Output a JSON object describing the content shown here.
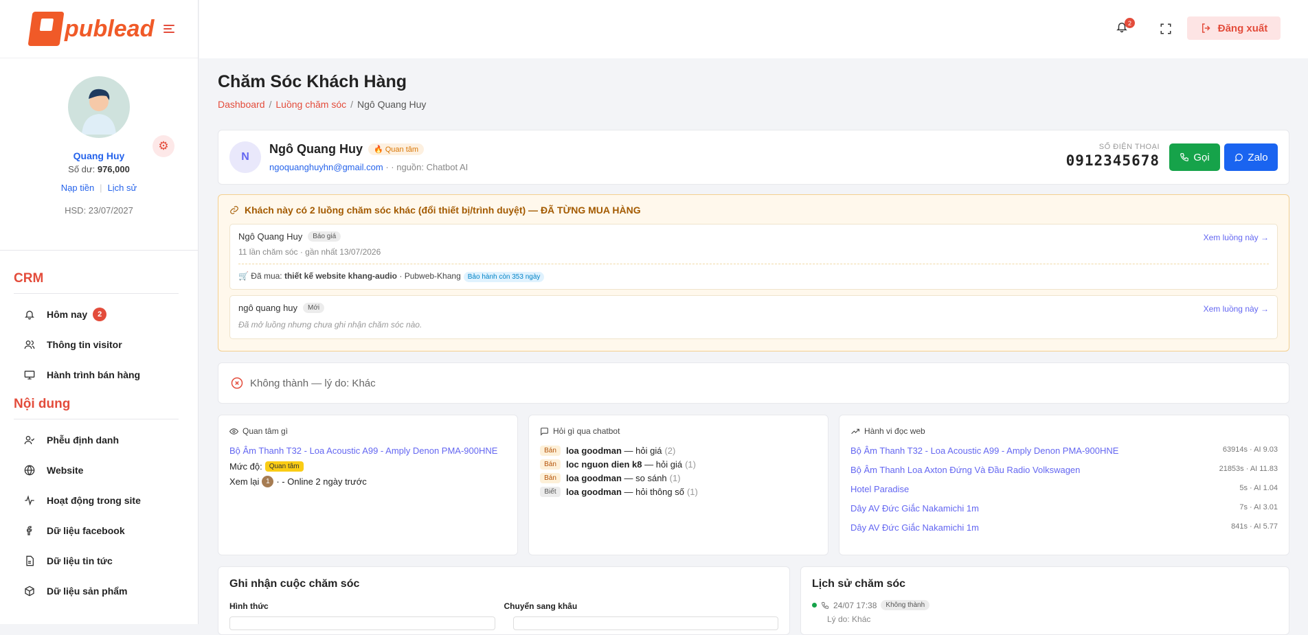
{
  "brand": {
    "name": "publead"
  },
  "profile": {
    "name": "Quang Huy",
    "balance_label": "Số dư:",
    "balance": "976,000",
    "topup": "Nạp tiền",
    "history": "Lịch sử",
    "expiry": "HSD: 23/07/2027"
  },
  "nav": {
    "crm_title": "CRM",
    "crm_items": [
      {
        "label": "Hôm nay",
        "badge": "2"
      },
      {
        "label": "Thông tin visitor"
      },
      {
        "label": "Hành trình bán hàng"
      }
    ],
    "content_title": "Nội dung",
    "content_items": [
      {
        "label": "Phễu định danh"
      },
      {
        "label": "Website"
      },
      {
        "label": "Hoạt động trong site"
      },
      {
        "label": "Dữ liệu facebook"
      },
      {
        "label": "Dữ liệu tin tức"
      },
      {
        "label": "Dữ liệu sản phẩm"
      }
    ]
  },
  "topbar": {
    "notif_count": "2",
    "logout": "Đăng xuất"
  },
  "page": {
    "title": "Chăm Sóc Khách Hàng",
    "breadcrumb": [
      "Dashboard",
      "Luồng chăm sóc",
      "Ngô Quang Huy"
    ]
  },
  "customer": {
    "initial": "N",
    "name": "Ngô Quang Huy",
    "tag": "🔥 Quan tâm",
    "email": "ngoquanghuyhn@gmail.com",
    "source": "· · nguồn: Chatbot AI",
    "phone_label": "SỐ ĐIỆN THOẠI",
    "phone": "0912345678",
    "call": "Gọi",
    "zalo": "Zalo"
  },
  "duplicates": {
    "title": "Khách này có 2 luồng chăm sóc khác (đổi thiết bị/trình duyệt) — ĐÃ TỪNG MUA HÀNG",
    "flows": [
      {
        "name": "Ngô Quang Huy",
        "tag": "Báo giá",
        "meta": "11 lần chăm sóc · gần nhất 13/07/2026",
        "buy_prefix": "🛒 Đã mua:",
        "buy_item": "thiết kế website khang-audio",
        "buy_suffix": "· Pubweb-Khang",
        "warranty": "Bảo hành còn 353 ngày",
        "link": "Xem luồng này →"
      },
      {
        "name": "ngô quang huy",
        "tag": "Mới",
        "note": "Đã mở luồng nhưng chưa ghi nhận chăm sóc nào.",
        "link": "Xem luồng này →"
      }
    ]
  },
  "status": {
    "text": "Không thành — lý do: Khác"
  },
  "interest": {
    "title": "Quan tâm gì",
    "product": "Bộ Âm Thanh T32 - Loa Acoustic A99 - Amply Denon PMA-900HNE",
    "level_label": "Mức độ:",
    "level": "Quan tâm",
    "revisit_label": "Xem lại",
    "revisit_count": "1",
    "revisit_suffix": "· - Online 2 ngày trước"
  },
  "chatbot": {
    "title": "Hỏi gì qua chatbot",
    "items": [
      {
        "kind": "Bán",
        "topic": "loa goodman",
        "intent": "— hỏi giá",
        "count": "(2)"
      },
      {
        "kind": "Bán",
        "topic": "loc nguon dien k8",
        "intent": "— hỏi giá",
        "count": "(1)"
      },
      {
        "kind": "Bán",
        "topic": "loa goodman",
        "intent": "— so sánh",
        "count": "(1)"
      },
      {
        "kind": "Biết",
        "topic": "loa goodman",
        "intent": "— hỏi thông số",
        "count": "(1)"
      }
    ]
  },
  "reading": {
    "title": "Hành vi đọc web",
    "items": [
      {
        "page": "Bộ Âm Thanh T32 - Loa Acoustic A99 - Amply Denon PMA-900HNE",
        "stat": "63914s · AI 9.03"
      },
      {
        "page": "Bộ Âm Thanh Loa Axton Đứng Và Đầu Radio Volkswagen",
        "stat": "21853s · AI 11.83"
      },
      {
        "page": "Hotel Paradise",
        "stat": "5s · AI 1.04"
      },
      {
        "page": "Dây AV Đức Giắc Nakamichi 1m",
        "stat": "7s · AI 3.01"
      },
      {
        "page": "Dây AV Đức Giắc Nakamichi 1m",
        "stat": "841s · AI 5.77"
      }
    ]
  },
  "record": {
    "title": "Ghi nhận cuộc chăm sóc",
    "form_label": "Hình thức",
    "stage_label": "Chuyển sang khâu"
  },
  "history": {
    "title": "Lịch sử chăm sóc",
    "time": "24/07 17:38",
    "status": "Không thành",
    "reason": "Lý do: Khác"
  },
  "colors": {
    "accent": "#e34c3b",
    "link": "#6366f1",
    "call": "#16a34a",
    "zalo": "#1a64f0"
  }
}
